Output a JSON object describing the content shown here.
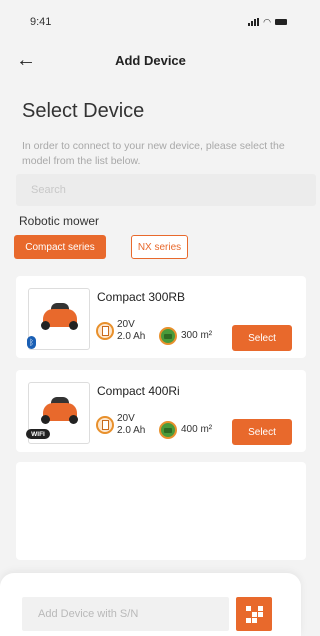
{
  "status_bar": {
    "time": "9:41"
  },
  "nav": {
    "title": "Add Device",
    "back_icon": "arrow-left-icon"
  },
  "section": {
    "title": "Select Device",
    "instructions": "In order to connect to your new device, please select the model from the list below."
  },
  "search": {
    "placeholder": "Search"
  },
  "category": {
    "label": "Robotic mower",
    "chips": [
      {
        "label": "Compact series",
        "active": true
      },
      {
        "label": "NX series",
        "active": false
      }
    ]
  },
  "devices": [
    {
      "name": "Compact 300RB",
      "voltage": "20V",
      "capacity": "2.0 Ah",
      "area": "300 m²",
      "connectivity": "bluetooth-icon",
      "select_label": "Select"
    },
    {
      "name": "Compact 400Ri",
      "voltage": "20V",
      "capacity": "2.0 Ah",
      "area": "400 m²",
      "connectivity": "wifi-badge-icon",
      "connectivity_label": "WIFI",
      "select_label": "Select"
    }
  ],
  "footer": {
    "sn_placeholder": "Add Device with S/N",
    "qr_icon": "qr-code-icon"
  },
  "colors": {
    "accent": "#e8692c",
    "background": "#f3f3f3"
  }
}
